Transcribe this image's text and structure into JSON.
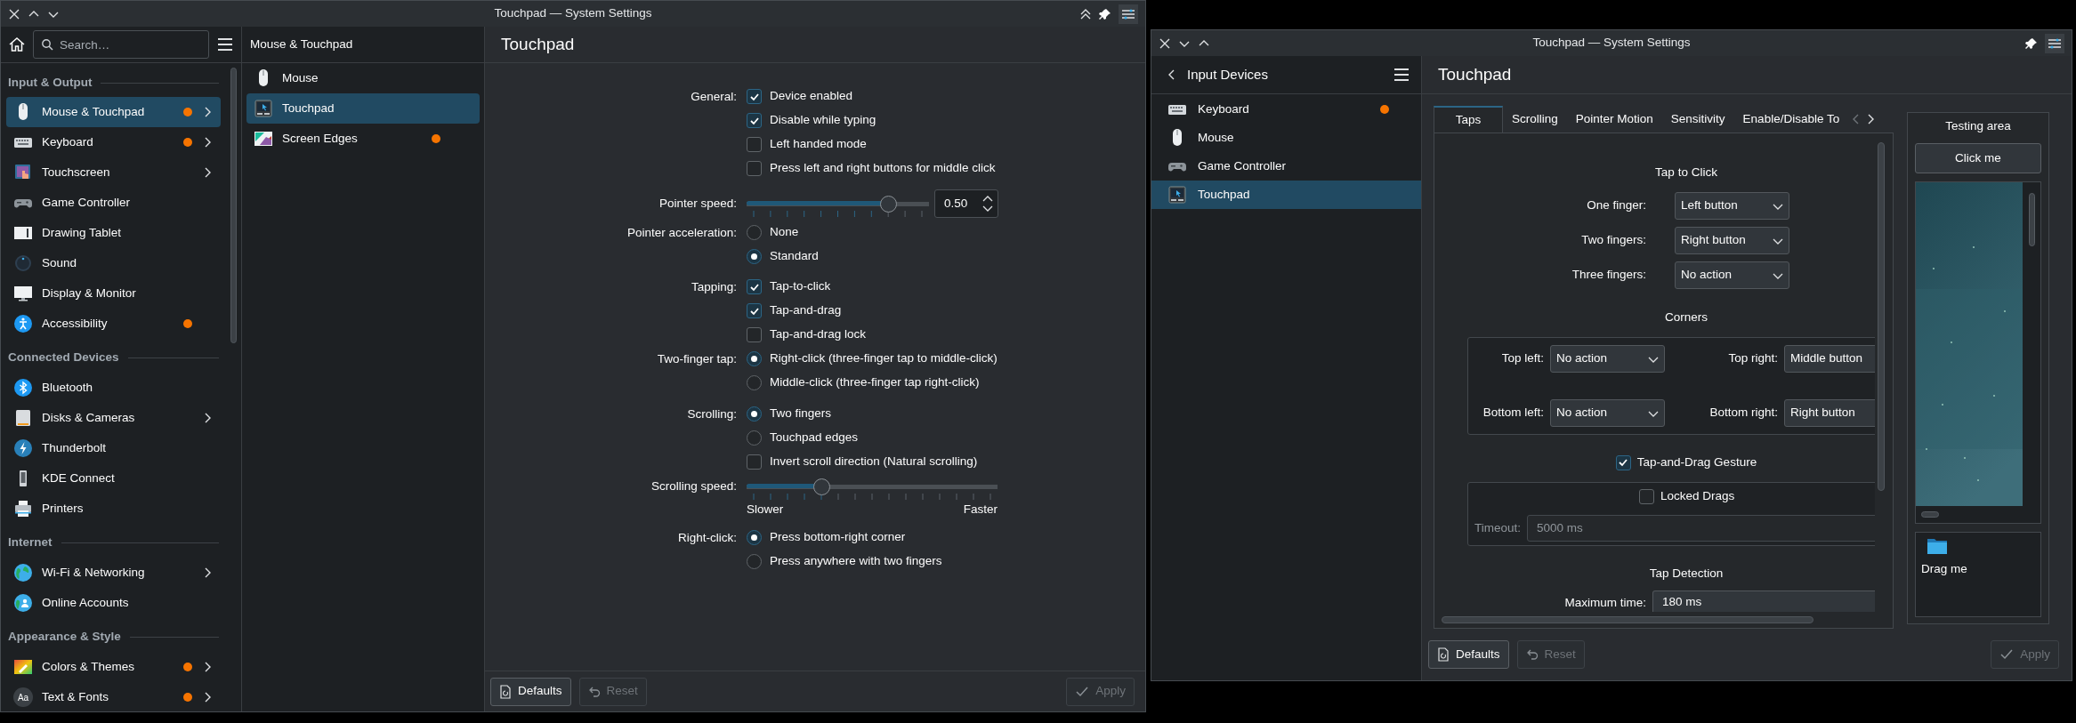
{
  "settings_window": {
    "title": "Touchpad — System Settings",
    "search": {
      "placeholder": "Search…"
    },
    "sections": [
      {
        "title": "Input & Output",
        "items": [
          {
            "label": "Mouse & Touchpad",
            "selected": true,
            "modified": true,
            "expandable": true
          },
          {
            "label": "Keyboard",
            "selected": false,
            "modified": true,
            "expandable": true
          },
          {
            "label": "Touchscreen",
            "selected": false,
            "modified": false,
            "expandable": true
          },
          {
            "label": "Game Controller",
            "selected": false,
            "modified": false,
            "expandable": false
          },
          {
            "label": "Drawing Tablet",
            "selected": false,
            "modified": false,
            "expandable": false
          },
          {
            "label": "Sound",
            "selected": false,
            "modified": false,
            "expandable": false
          },
          {
            "label": "Display & Monitor",
            "selected": false,
            "modified": false,
            "expandable": false
          },
          {
            "label": "Accessibility",
            "selected": false,
            "modified": true,
            "expandable": false
          }
        ]
      },
      {
        "title": "Connected Devices",
        "items": [
          {
            "label": "Bluetooth",
            "selected": false,
            "modified": false,
            "expandable": false
          },
          {
            "label": "Disks & Cameras",
            "selected": false,
            "modified": false,
            "expandable": true
          },
          {
            "label": "Thunderbolt",
            "selected": false,
            "modified": false,
            "expandable": false
          },
          {
            "label": "KDE Connect",
            "selected": false,
            "modified": false,
            "expandable": false
          },
          {
            "label": "Printers",
            "selected": false,
            "modified": false,
            "expandable": false
          }
        ]
      },
      {
        "title": "Internet",
        "items": [
          {
            "label": "Wi-Fi & Networking",
            "selected": false,
            "modified": false,
            "expandable": true
          },
          {
            "label": "Online Accounts",
            "selected": false,
            "modified": false,
            "expandable": false
          }
        ]
      },
      {
        "title": "Appearance & Style",
        "items": [
          {
            "label": "Colors & Themes",
            "selected": false,
            "modified": true,
            "expandable": true
          },
          {
            "label": "Text & Fonts",
            "selected": false,
            "modified": true,
            "expandable": true,
            "icon_text": "Aa"
          }
        ]
      }
    ],
    "category_title": "Mouse & Touchpad",
    "subpages": [
      {
        "label": "Mouse",
        "selected": false,
        "modified": false
      },
      {
        "label": "Touchpad",
        "selected": true,
        "modified": false
      },
      {
        "label": "Screen Edges",
        "selected": false,
        "modified": true
      }
    ],
    "page_title": "Touchpad",
    "form": [
      {
        "label": "General:",
        "items": [
          {
            "kind": "checkbox",
            "text": "Device enabled",
            "checked": true
          },
          {
            "kind": "checkbox",
            "text": "Disable while typing",
            "checked": true
          },
          {
            "kind": "checkbox",
            "text": "Left handed mode",
            "checked": false
          },
          {
            "kind": "checkbox",
            "text": "Press left and right buttons for middle click",
            "checked": false
          }
        ]
      },
      {
        "label": "Pointer speed:",
        "items": [
          {
            "kind": "slider",
            "level": 0.78,
            "value": "0.50"
          }
        ]
      },
      {
        "label": "Pointer acceleration:",
        "items": [
          {
            "kind": "radio",
            "text": "None",
            "selected": false
          },
          {
            "kind": "radio",
            "text": "Standard",
            "selected": true
          }
        ]
      },
      {
        "label": "Tapping:",
        "items": [
          {
            "kind": "checkbox",
            "text": "Tap-to-click",
            "checked": true
          },
          {
            "kind": "checkbox",
            "text": "Tap-and-drag",
            "checked": true
          },
          {
            "kind": "checkbox",
            "text": "Tap-and-drag lock",
            "checked": false
          }
        ]
      },
      {
        "label": "Two-finger tap:",
        "items": [
          {
            "kind": "radio",
            "text": "Right-click (three-finger tap to middle-click)",
            "selected": true
          },
          {
            "kind": "radio",
            "text": "Middle-click (three-finger tap right-click)",
            "selected": false
          }
        ]
      },
      {
        "label": "Scrolling:",
        "items": [
          {
            "kind": "radio",
            "text": "Two fingers",
            "selected": true
          },
          {
            "kind": "radio",
            "text": "Touchpad edges",
            "selected": false
          },
          {
            "kind": "checkbox",
            "text": "Invert scroll direction (Natural scrolling)",
            "checked": false
          }
        ]
      },
      {
        "label": "Scrolling speed:",
        "items": [
          {
            "kind": "slider",
            "level": 0.3,
            "min_label": "Slower",
            "max_label": "Faster"
          }
        ]
      },
      {
        "label": "Right-click:",
        "items": [
          {
            "kind": "radio",
            "text": "Press bottom-right corner",
            "selected": true
          },
          {
            "kind": "radio",
            "text": "Press anywhere with two fingers",
            "selected": false
          }
        ]
      }
    ],
    "buttons": [
      {
        "label": "Defaults",
        "disabled": false
      },
      {
        "label": "Reset",
        "disabled": true
      },
      {
        "label": "Apply",
        "disabled": true
      }
    ]
  },
  "input_devices_window": {
    "title": "Touchpad — System Settings",
    "back_title": "Input Devices",
    "devices": [
      {
        "label": "Keyboard",
        "selected": false,
        "modified": true
      },
      {
        "label": "Mouse",
        "selected": false,
        "modified": false
      },
      {
        "label": "Game Controller",
        "selected": false,
        "modified": false
      },
      {
        "label": "Touchpad",
        "selected": true,
        "modified": false
      }
    ],
    "page_title": "Touchpad",
    "tabs": [
      {
        "label": "Taps",
        "selected": true
      },
      {
        "label": "Scrolling",
        "selected": false
      },
      {
        "label": "Pointer Motion",
        "selected": false
      },
      {
        "label": "Sensitivity",
        "selected": false
      },
      {
        "label": "Enable/Disable To",
        "selected": false
      }
    ],
    "tap_to_click": {
      "title": "Tap to Click",
      "rows": [
        {
          "label": "One finger:",
          "value": "Left button"
        },
        {
          "label": "Two fingers:",
          "value": "Right button"
        },
        {
          "label": "Three fingers:",
          "value": "No action"
        }
      ]
    },
    "corners": {
      "title": "Corners",
      "rows": [
        {
          "label": "Top left:",
          "value": "No action"
        },
        {
          "label": "Top right:",
          "value": "Middle button"
        },
        {
          "label": "Bottom left:",
          "value": "No action"
        },
        {
          "label": "Bottom right:",
          "value": "Right button"
        }
      ]
    },
    "tap_and_drag": {
      "label": "Tap-and-Drag Gesture",
      "checked": true
    },
    "locked_drags": {
      "label": "Locked Drags",
      "checked": false
    },
    "timeout": {
      "label": "Timeout:",
      "value": "5000 ms",
      "disabled": true
    },
    "tap_detection": {
      "title": "Tap Detection",
      "rows": [
        {
          "label": "Maximum time:",
          "value": "180 ms"
        }
      ]
    },
    "testing_area": {
      "title": "Testing area",
      "button": "Click me",
      "drag_label": "Drag me"
    },
    "buttons": [
      {
        "label": "Defaults",
        "disabled": false
      },
      {
        "label": "Reset",
        "disabled": true
      },
      {
        "label": "Apply",
        "disabled": true
      }
    ]
  }
}
